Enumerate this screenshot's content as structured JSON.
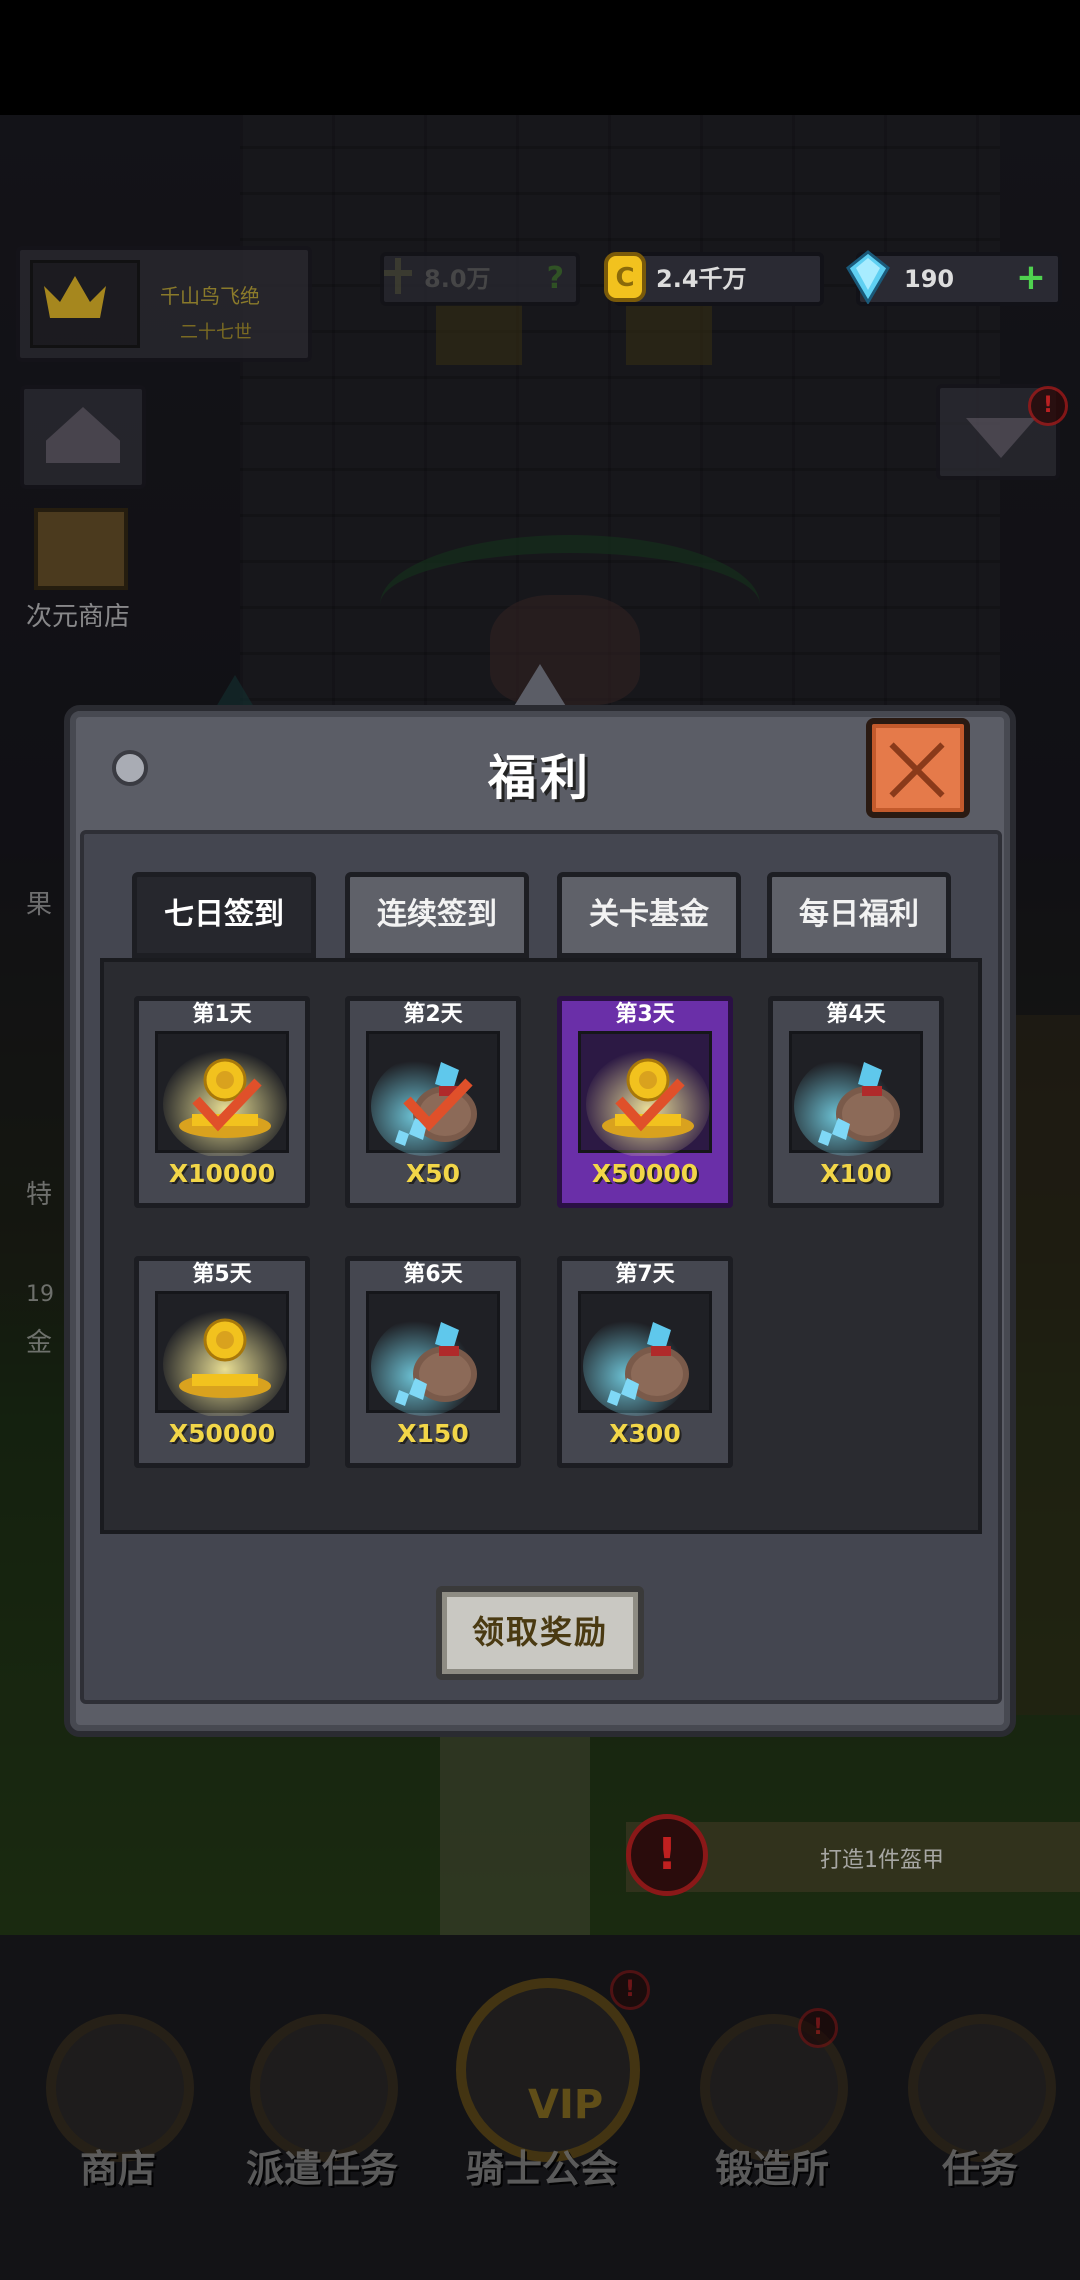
{
  "hud": {
    "player_name": "千山鸟飞绝",
    "player_subtitle": "二十七世",
    "power_value": "8.0万",
    "power_hint": "?",
    "gold_value": "2.4千万",
    "gem_value": "190",
    "gem_add": "+"
  },
  "side": {
    "shop_label": "次元商店",
    "label_fragments": [
      "果",
      "特",
      "19",
      "金"
    ]
  },
  "modal": {
    "title": "福利",
    "close_icon": "close-icon",
    "tabs": [
      {
        "label": "七日签到",
        "active": true
      },
      {
        "label": "连续签到",
        "active": false
      },
      {
        "label": "关卡基金",
        "active": false
      },
      {
        "label": "每日福利",
        "active": false
      }
    ],
    "days": [
      {
        "label": "第1天",
        "amount": "X10000",
        "reward": "gold",
        "claimed": true,
        "highlight": false
      },
      {
        "label": "第2天",
        "amount": "X50",
        "reward": "gem",
        "claimed": true,
        "highlight": false
      },
      {
        "label": "第3天",
        "amount": "X50000",
        "reward": "gold",
        "claimed": true,
        "highlight": true
      },
      {
        "label": "第4天",
        "amount": "X100",
        "reward": "gem",
        "claimed": false,
        "highlight": false
      },
      {
        "label": "第5天",
        "amount": "X50000",
        "reward": "gold",
        "claimed": false,
        "highlight": false
      },
      {
        "label": "第6天",
        "amount": "X150",
        "reward": "gem",
        "claimed": false,
        "highlight": false
      },
      {
        "label": "第7天",
        "amount": "X300",
        "reward": "gem",
        "claimed": false,
        "highlight": false
      }
    ],
    "claim_button": "领取奖励"
  },
  "task": {
    "alert": "!",
    "text": "打造1件盔甲"
  },
  "nav": {
    "items": [
      {
        "label": "商店",
        "icon": "shop-icon"
      },
      {
        "label": "派遣任务",
        "icon": "dispatch-icon"
      },
      {
        "label": "骑士公会",
        "icon": "knight-helmet-icon"
      },
      {
        "label": "锻造所",
        "icon": "forge-icon"
      },
      {
        "label": "任务",
        "icon": "scroll-icon"
      }
    ],
    "vip_label": "VIP"
  },
  "colors": {
    "gold_text": "#f2d648",
    "highlight_card": "#6a2fa8",
    "close_button": "#e57a4a",
    "check_mark": "#e0502a"
  }
}
